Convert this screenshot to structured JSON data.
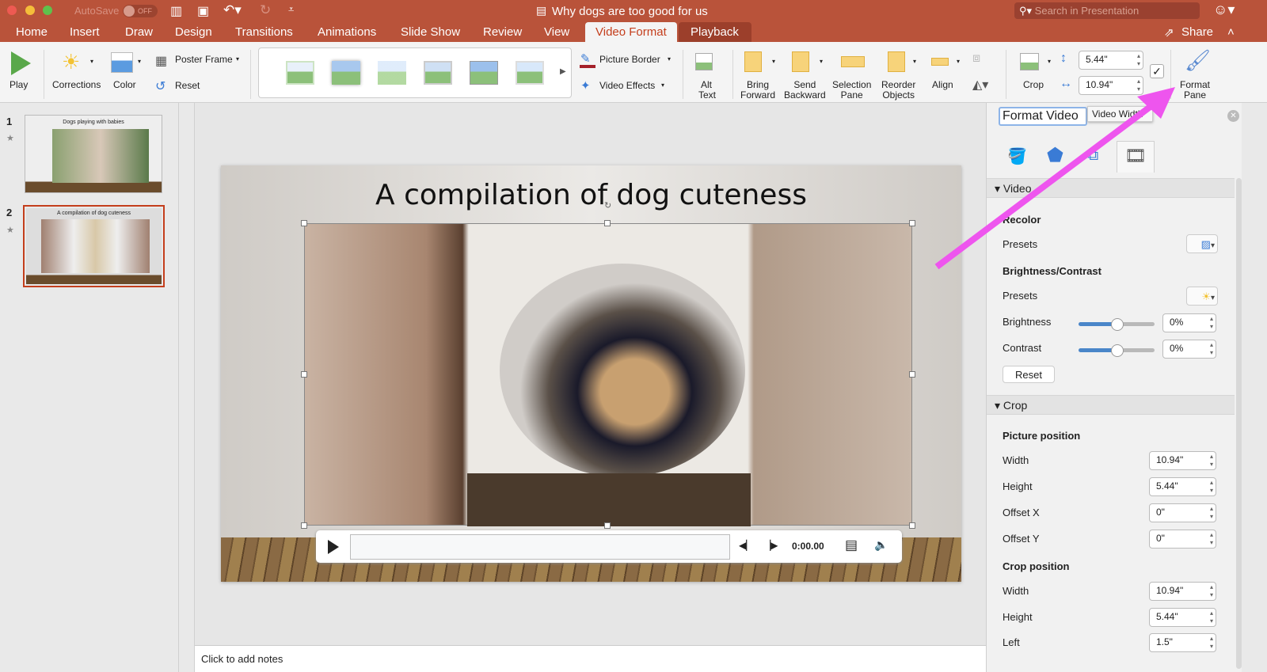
{
  "window": {
    "title": "Why dogs are too good for us",
    "autosave_label": "AutoSave",
    "autosave_state": "OFF",
    "search_placeholder": "Search in Presentation"
  },
  "tabs": [
    "Home",
    "Insert",
    "Draw",
    "Design",
    "Transitions",
    "Animations",
    "Slide Show",
    "Review",
    "View",
    "Video Format",
    "Playback"
  ],
  "active_tab": "Video Format",
  "share_label": "Share",
  "ribbon": {
    "play": "Play",
    "corrections": "Corrections",
    "color": "Color",
    "poster_frame": "Poster Frame",
    "reset": "Reset",
    "picture_border": "Picture Border",
    "video_effects": "Video Effects",
    "alt_text": [
      "Alt",
      "Text"
    ],
    "bring_forward": [
      "Bring",
      "Forward"
    ],
    "send_backward": [
      "Send",
      "Backward"
    ],
    "selection_pane": [
      "Selection",
      "Pane"
    ],
    "reorder_objects": [
      "Reorder",
      "Objects"
    ],
    "align": "Align",
    "crop": "Crop",
    "height": "5.44\"",
    "width": "10.94\"",
    "format_pane": [
      "Format",
      "Pane"
    ]
  },
  "slides": [
    {
      "number": "1",
      "title": "Dogs playing with babies"
    },
    {
      "number": "2",
      "title": "A compilation of dog cuteness"
    }
  ],
  "selected_slide": 2,
  "slide": {
    "title": "A compilation of dog cuteness"
  },
  "player": {
    "time": "0:00.00",
    "progress": 0
  },
  "notes_placeholder": "Click to add notes",
  "pane": {
    "title": "Format Video",
    "tooltip": "Video Width",
    "section_video": "Video",
    "recolor": "Recolor",
    "presets": "Presets",
    "brightness_contrast": "Brightness/Contrast",
    "brightness": "Brightness",
    "brightness_value": "0%",
    "contrast": "Contrast",
    "contrast_value": "0%",
    "reset": "Reset",
    "section_crop": "Crop",
    "picture_position": "Picture position",
    "pp_width_label": "Width",
    "pp_width": "10.94\"",
    "pp_height_label": "Height",
    "pp_height": "5.44\"",
    "offset_x_label": "Offset X",
    "offset_x": "0\"",
    "offset_y_label": "Offset Y",
    "offset_y": "0\"",
    "crop_position": "Crop position",
    "cp_width_label": "Width",
    "cp_width": "10.94\"",
    "cp_height_label": "Height",
    "cp_height": "5.44\"",
    "left_label": "Left",
    "left": "1.5\""
  },
  "colors": {
    "titlebar": "#b9533a",
    "accent": "#c43e1c",
    "annotation_arrow": "#ee55ee",
    "slider": "#4a86c9"
  }
}
